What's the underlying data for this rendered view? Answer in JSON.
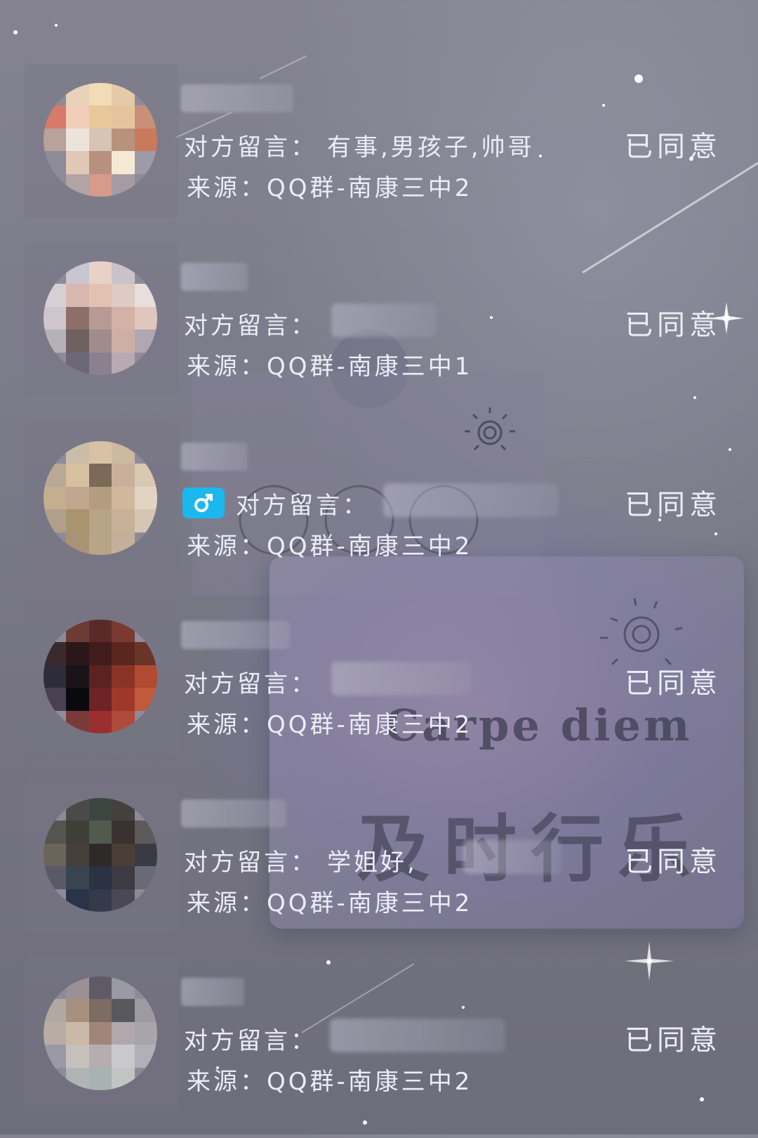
{
  "requests": [
    {
      "message_label": "对方留言：",
      "message_text": "有事,男孩子,帅哥",
      "source": "来源：QQ群-南康三中2",
      "status": "已同意",
      "gender_icon": "",
      "avatar_colors": [
        "#8e8b98",
        "#e8d2b8",
        "#f1dcb6",
        "#e6c9a6",
        "#8f8b98",
        "#d67a6a",
        "#f0cdb8",
        "#e8c79a",
        "#e4c49c",
        "#c89078",
        "#b8a29a",
        "#ece4dc",
        "#d6c4b4",
        "#b8927c",
        "#c97a5a",
        "#8e8b98",
        "#e0c8b4",
        "#b89080",
        "#f4ead4",
        "#9e9aa6",
        "#8e8b98",
        "#b2a4a4",
        "#d89a8a",
        "#a69aa4",
        "#8e8b98"
      ]
    },
    {
      "message_label": "对方留言：",
      "message_text": "",
      "source": "来源：QQ群-南康三中1",
      "status": "已同意",
      "gender_icon": "",
      "avatar_colors": [
        "#8e8b98",
        "#c8c6d0",
        "#e8d2c8",
        "#c9c2c8",
        "#8e8b98",
        "#d6d0d4",
        "#d8b8b0",
        "#e2c0b2",
        "#dccac4",
        "#e8dedc",
        "#cfc6cc",
        "#8c6e6a",
        "#b89a94",
        "#d4b0a6",
        "#e0c6bc",
        "#b6b0b8",
        "#6e6260",
        "#a08c8a",
        "#cfaea6",
        "#b0a8b0",
        "#8e8b98",
        "#6c6878",
        "#8a8090",
        "#b8aab2",
        "#8e8b98"
      ]
    },
    {
      "message_label": "对方留言：",
      "message_text": "",
      "source": "来源：QQ群-南康三中2",
      "status": "已同意",
      "gender_icon": "male-icon",
      "avatar_colors": [
        "#8e8b98",
        "#cbbca8",
        "#d8c2a6",
        "#cdb8a0",
        "#8e8b98",
        "#b8a894",
        "#d6c0a0",
        "#7a6a58",
        "#c8b09a",
        "#d8c8b4",
        "#c4ae90",
        "#c0a890",
        "#b49c80",
        "#d0b89c",
        "#e2d4c2",
        "#b0a08a",
        "#a8946e",
        "#b8a486",
        "#c6b096",
        "#d4c6b2",
        "#8e8b98",
        "#a89474",
        "#b8a486",
        "#c4b09a",
        "#8e8b98"
      ]
    },
    {
      "message_label": "对方留言：",
      "message_text": "",
      "source": "来源：QQ群-南康三中2",
      "status": "已同意",
      "gender_icon": "",
      "avatar_colors": [
        "#8e8b98",
        "#6e3a34",
        "#5a2a28",
        "#7a3a30",
        "#8e8b98",
        "#3a2a2e",
        "#2a1818",
        "#401c1c",
        "#5a2620",
        "#6a3428",
        "#2c2c3a",
        "#1a1418",
        "#5a2220",
        "#8a3426",
        "#b04a30",
        "#4a4052",
        "#0a0a0e",
        "#6e2424",
        "#a0382a",
        "#c05a38",
        "#8e8b98",
        "#7a3a3a",
        "#9a2e2e",
        "#b04a3a",
        "#8e8b98"
      ]
    },
    {
      "message_label": "对方留言：",
      "message_text": "学姐好,",
      "source": "来源：QQ群-南康三中2",
      "status": "已同意",
      "gender_icon": "",
      "avatar_colors": [
        "#8e8b98",
        "#4a4a48",
        "#3c4640",
        "#44403e",
        "#8e8b98",
        "#565450",
        "#3e4038",
        "#525a4e",
        "#3a3230",
        "#5e5a5c",
        "#6a645a",
        "#46403a",
        "#2e2a2a",
        "#4a3e38",
        "#3a3a44",
        "#5a5a66",
        "#3a4450",
        "#2a3244",
        "#3c3a42",
        "#6a6a76",
        "#8e8b98",
        "#2a3448",
        "#343a4a",
        "#4a4856",
        "#8e8b98"
      ]
    },
    {
      "message_label": "对方留言：",
      "message_text": "",
      "source": "来源：QQ群-南康三中2",
      "status": "已同意",
      "gender_icon": "",
      "avatar_colors": [
        "#8e8b98",
        "#9a9098",
        "#5e5a66",
        "#9a9aa4",
        "#8e8b98",
        "#b2a8a2",
        "#a89080",
        "#7e6c62",
        "#58585e",
        "#9e9aa2",
        "#b8aca4",
        "#cab8a8",
        "#a08678",
        "#b0a8ac",
        "#a8a4ac",
        "#9a9aa6",
        "#c8c0bc",
        "#b4aeb0",
        "#cac8cc",
        "#b0b0b8",
        "#8e8b98",
        "#b0b4b4",
        "#a8b2b0",
        "#c2c4c4",
        "#8e8b98"
      ]
    }
  ]
}
